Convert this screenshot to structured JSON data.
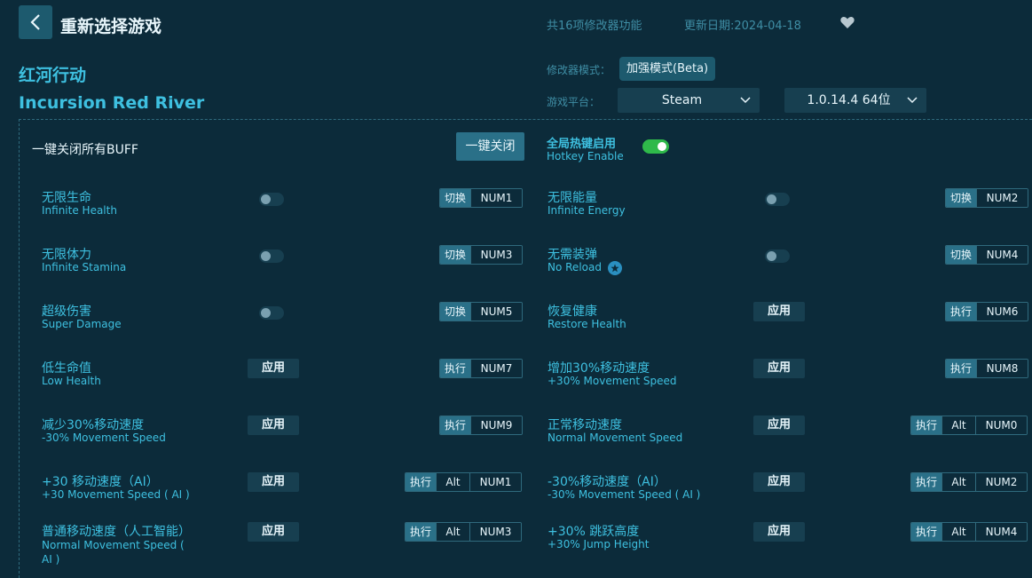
{
  "header": {
    "title": "重新选择游戏",
    "count_text": "共16项修改器功能",
    "date_text": "更新日期:2024-04-18"
  },
  "game": {
    "name_cn": "红河行动",
    "name_en": "Incursion Red River"
  },
  "settings": {
    "mode_label": "修改器模式：",
    "mode_value": "加强模式(Beta)",
    "platform_label": "游戏平台：",
    "platform_value": "Steam",
    "version_value": "1.0.14.4 64位"
  },
  "global": {
    "buff_label": "一键关闭所有BUFF",
    "close_all_label": "一键关闭",
    "hotkey_cn": "全局热键启用",
    "hotkey_en": "Hotkey Enable",
    "hotkey_enabled": true
  },
  "features": [
    {
      "cn": "无限生命",
      "en": "Infinite Health",
      "control": "toggle",
      "control_label": "",
      "kind": "切换",
      "keys": [
        "NUM1"
      ]
    },
    {
      "cn": "无限能量",
      "en": "Infinite Energy",
      "control": "toggle",
      "control_label": "",
      "kind": "切换",
      "keys": [
        "NUM2"
      ]
    },
    {
      "cn": "无限体力",
      "en": "Infinite Stamina",
      "control": "toggle",
      "control_label": "",
      "kind": "切换",
      "keys": [
        "NUM3"
      ]
    },
    {
      "cn": "无需装弹",
      "en": "No Reload",
      "control": "toggle",
      "control_label": "",
      "kind": "切换",
      "keys": [
        "NUM4"
      ],
      "starred": true
    },
    {
      "cn": "超级伤害",
      "en": "Super Damage",
      "control": "toggle",
      "control_label": "",
      "kind": "切换",
      "keys": [
        "NUM5"
      ]
    },
    {
      "cn": "恢复健康",
      "en": "Restore Health",
      "control": "apply",
      "control_label": "应用",
      "kind": "执行",
      "keys": [
        "NUM6"
      ]
    },
    {
      "cn": "低生命值",
      "en": "Low Health",
      "control": "apply",
      "control_label": "应用",
      "kind": "执行",
      "keys": [
        "NUM7"
      ]
    },
    {
      "cn": "增加30%移动速度",
      "en": "+30% Movement Speed",
      "control": "apply",
      "control_label": "应用",
      "kind": "执行",
      "keys": [
        "NUM8"
      ]
    },
    {
      "cn": "减少30%移动速度",
      "en": "-30% Movement Speed",
      "control": "apply",
      "control_label": "应用",
      "kind": "执行",
      "keys": [
        "NUM9"
      ]
    },
    {
      "cn": "正常移动速度",
      "en": "Normal Movement Speed",
      "control": "apply",
      "control_label": "应用",
      "kind": "执行",
      "keys": [
        "Alt",
        "NUM0"
      ]
    },
    {
      "cn": "+30 移动速度（AI）",
      "en": "+30 Movement Speed ( AI )",
      "control": "apply",
      "control_label": "应用",
      "kind": "执行",
      "keys": [
        "Alt",
        "NUM1"
      ]
    },
    {
      "cn": "-30%移动速度（AI）",
      "en": "-30% Movement Speed ( AI )",
      "control": "apply",
      "control_label": "应用",
      "kind": "执行",
      "keys": [
        "Alt",
        "NUM2"
      ]
    },
    {
      "cn": "普通移动速度（人工智能）",
      "en": "Normal Movement Speed ( AI )",
      "control": "apply",
      "control_label": "应用",
      "kind": "执行",
      "keys": [
        "Alt",
        "NUM3"
      ]
    },
    {
      "cn": "+30% 跳跃高度",
      "en": "+30% Jump Height",
      "control": "apply",
      "control_label": "应用",
      "kind": "执行",
      "keys": [
        "Alt",
        "NUM4"
      ]
    }
  ]
}
